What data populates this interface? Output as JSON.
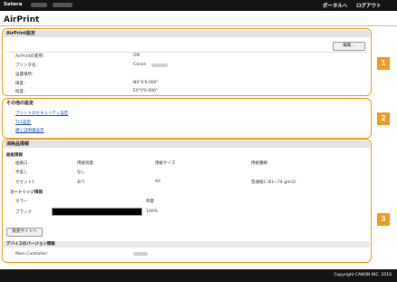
{
  "topbar": {
    "brand": "Setera",
    "portal": "ポータルへ",
    "logout": "ログアウト"
  },
  "page": {
    "title": "AirPrint"
  },
  "airprint_settings": {
    "heading": "AirPrint設定",
    "edit_button": "編集...",
    "rows": [
      {
        "label": "AirPrintの使用：",
        "value": "ON"
      },
      {
        "label": "プリンタ名：",
        "value": "Canon"
      },
      {
        "label": "設置場所：",
        "value": ""
      },
      {
        "label": "緯度：",
        "value": "N0°0'0.000\""
      },
      {
        "label": "経度：",
        "value": "E0°0'0.000\""
      }
    ]
  },
  "other_settings": {
    "heading": "その他の設定",
    "links": [
      "プリントのセキュリティ設定",
      "TLS設定",
      "鍵と証明書設定"
    ]
  },
  "consumables": {
    "heading": "消耗品情報",
    "paper": {
      "subheading": "給紙情報",
      "columns": [
        "給紙口",
        "用紙残量",
        "用紙サイズ",
        "用紙種類"
      ],
      "rows": [
        [
          "手差し",
          "なし",
          "",
          ""
        ],
        [
          "カセット1",
          "あり",
          "A4",
          "普通紙1 (61~74 g/m2)"
        ]
      ]
    },
    "cartridge": {
      "subheading": "カートリッジ情報",
      "columns": [
        "カラー",
        "残量"
      ],
      "rows": [
        {
          "color": "ブラック",
          "level": "100%"
        }
      ]
    },
    "sales_site_button": "販売サイトへ",
    "version": {
      "subheading": "デバイスのバージョン情報",
      "label": "Main Controller："
    }
  },
  "badges": [
    "1",
    "2",
    "3"
  ],
  "footer": {
    "copyright": "Copyright CANON INC. 2018"
  },
  "colors": {
    "accent": "#f29b1f",
    "bar": "#141414",
    "link": "#1a4fb6"
  }
}
